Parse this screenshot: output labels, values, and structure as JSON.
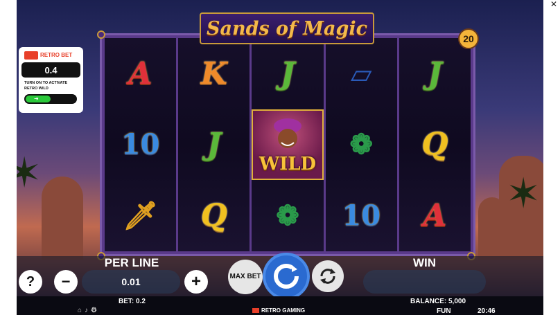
{
  "game": {
    "title": "Sands of Magic",
    "lines_count": "20"
  },
  "reels": [
    [
      "A",
      "10",
      "dagger"
    ],
    [
      "K",
      "J",
      "Q"
    ],
    [
      "J",
      "WILD",
      "turban"
    ],
    [
      "carpet",
      "turban",
      "10"
    ],
    [
      "J",
      "Q",
      "A"
    ]
  ],
  "retro_bet": {
    "logo_text": "RETRO BET",
    "value": "0.4",
    "caption": "TURN ON TO ACTIVATE RETRO WILD"
  },
  "controls": {
    "help_label": "?",
    "minus_label": "−",
    "plus_label": "+",
    "per_line_label": "PER LINE",
    "per_line_value": "0.01",
    "max_bet_label": "MAX BET",
    "win_label": "WIN",
    "win_value": ""
  },
  "status": {
    "bet": "BET: 0.2",
    "balance": "BALANCE: 5,000",
    "mode": "FUN",
    "time": "20:46",
    "brand": "RETRO GAMING"
  },
  "colors": {
    "accent_gold": "#f4b43a",
    "spin_blue": "#2a6ad0",
    "toggle_green": "#2ac83a"
  }
}
